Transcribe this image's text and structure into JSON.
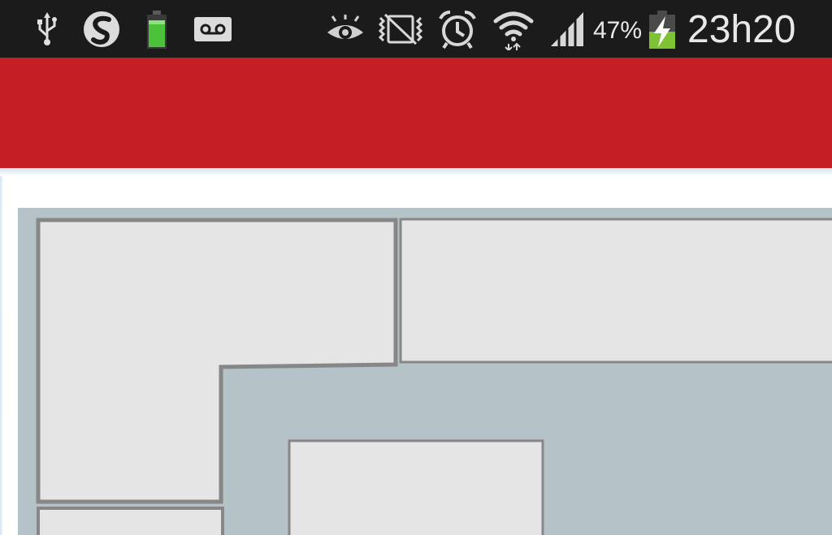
{
  "status_bar": {
    "left_icons": [
      "usb-icon",
      "sync-icon",
      "battery-widget-icon",
      "voicemail-icon"
    ],
    "right_icons": [
      "eye-icon",
      "silent-mode-icon",
      "alarm-icon",
      "wifi-icon",
      "signal-icon",
      "battery-charging-icon"
    ],
    "battery_percent": "47%",
    "time": "23h20"
  },
  "app_bar": {
    "color": "#c31f25"
  },
  "floor_map": {
    "background_color": "#b5c3c9",
    "room_fill": "#e5e5e5",
    "wall_color": "#878787",
    "rooms": [
      "room-l-shaped",
      "room-top-right",
      "room-center",
      "room-bottom-left"
    ]
  }
}
